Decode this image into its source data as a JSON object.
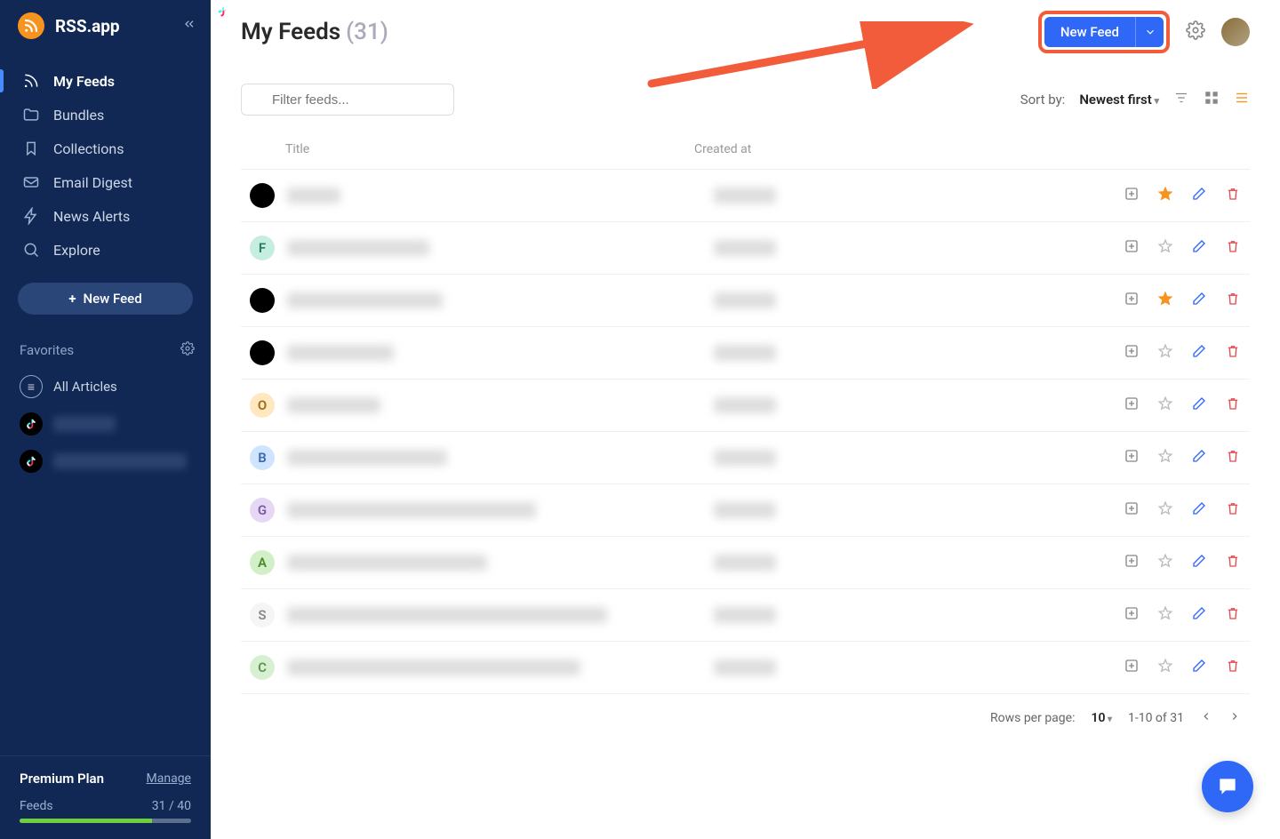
{
  "app": {
    "name": "RSS.app"
  },
  "sidebar": {
    "nav": [
      {
        "label": "My Feeds",
        "icon": "rss"
      },
      {
        "label": "Bundles",
        "icon": "folder"
      },
      {
        "label": "Collections",
        "icon": "bookmark"
      },
      {
        "label": "Email Digest",
        "icon": "mail"
      },
      {
        "label": "News Alerts",
        "icon": "zap"
      },
      {
        "label": "Explore",
        "icon": "search"
      }
    ],
    "new_feed": "New Feed",
    "favorites_label": "Favorites",
    "all_articles": "All Articles",
    "footer": {
      "plan": "Premium Plan",
      "manage": "Manage",
      "feeds_label": "Feeds",
      "feeds_count": "31 / 40",
      "progress_pct": 77.5
    }
  },
  "header": {
    "title": "My Feeds",
    "count": "(31)",
    "new_feed": "New Feed"
  },
  "toolbar": {
    "filter_placeholder": "Filter feeds...",
    "sort_label": "Sort by:",
    "sort_value": "Newest first"
  },
  "table": {
    "columns": {
      "title": "Title",
      "created": "Created at"
    },
    "rows": [
      {
        "icon_type": "tiktok",
        "letter": "",
        "bg": "#000",
        "fg": "#fff",
        "title_w": 60,
        "starred": true
      },
      {
        "icon_type": "letter",
        "letter": "F",
        "bg": "#c5ede0",
        "fg": "#2a7a5f",
        "title_w": 160,
        "starred": false
      },
      {
        "icon_type": "tiktok",
        "letter": "",
        "bg": "#000",
        "fg": "#fff",
        "title_w": 175,
        "starred": true
      },
      {
        "icon_type": "tiktok",
        "letter": "",
        "bg": "#000",
        "fg": "#fff",
        "title_w": 120,
        "starred": false
      },
      {
        "icon_type": "letter",
        "letter": "O",
        "bg": "#ffe7bf",
        "fg": "#a06a1a",
        "title_w": 105,
        "starred": false
      },
      {
        "icon_type": "letter",
        "letter": "B",
        "bg": "#cfe4ff",
        "fg": "#3a6bb0",
        "title_w": 180,
        "starred": false
      },
      {
        "icon_type": "letter",
        "letter": "G",
        "bg": "#e6d8f5",
        "fg": "#7a5aa6",
        "title_w": 280,
        "starred": false
      },
      {
        "icon_type": "letter",
        "letter": "A",
        "bg": "#d2f0c8",
        "fg": "#4a8a2e",
        "title_w": 225,
        "starred": false
      },
      {
        "icon_type": "letter",
        "letter": "S",
        "bg": "#f5f5f5",
        "fg": "#888",
        "title_w": 360,
        "starred": false
      },
      {
        "icon_type": "letter",
        "letter": "C",
        "bg": "#d8f0d2",
        "fg": "#5a9648",
        "title_w": 330,
        "starred": false
      }
    ]
  },
  "pager": {
    "rpp_label": "Rows per page:",
    "rpp_value": "10",
    "range": "1-10 of 31"
  }
}
